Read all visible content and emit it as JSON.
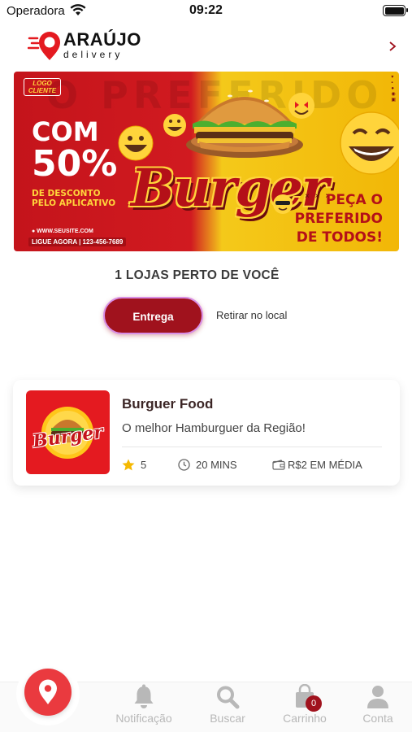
{
  "status_bar": {
    "carrier": "Operadora",
    "time": "09:22"
  },
  "header": {
    "brand": "ARAÚJO",
    "brand_sub": "delivery"
  },
  "banner": {
    "background_word": "O PREFERIDO",
    "logo_label": "LOGO CLIENTE",
    "headline_1": "COM",
    "headline_2": "50%",
    "desc_line_1": "DE DESCONTO",
    "desc_line_2": "PELO APLICATIVO",
    "website": "● WWW.SEUSITE.COM",
    "call": "LIGUE AGORA | 123-456-7689",
    "burger_word": "Burger",
    "cta_line_1": "PEÇA O",
    "cta_line_2": "PREFERIDO",
    "cta_line_3": "DE TODOS!",
    "dots": "× × ×"
  },
  "nearby": {
    "title": "1 LOJAS PERTO DE VOCÊ"
  },
  "mode": {
    "delivery_label": "Entrega",
    "pickup_label": "Retirar no local",
    "selected": "Entrega"
  },
  "stores": [
    {
      "name": "Burguer Food",
      "description": "O melhor Hamburguer da Região!",
      "logo_text": "Burger",
      "rating": "5",
      "time": "20 MINS",
      "price": "R$2 EM MÉDIA"
    }
  ],
  "tabbar": {
    "notifications_label": "Notificação",
    "search_label": "Buscar",
    "cart_label": "Carrinho",
    "cart_count": "0",
    "account_label": "Conta"
  },
  "colors": {
    "primary": "#a0121d",
    "fab": "#ea3a3f",
    "star": "#f5b800",
    "tab_inactive": "#b8b8b8"
  }
}
